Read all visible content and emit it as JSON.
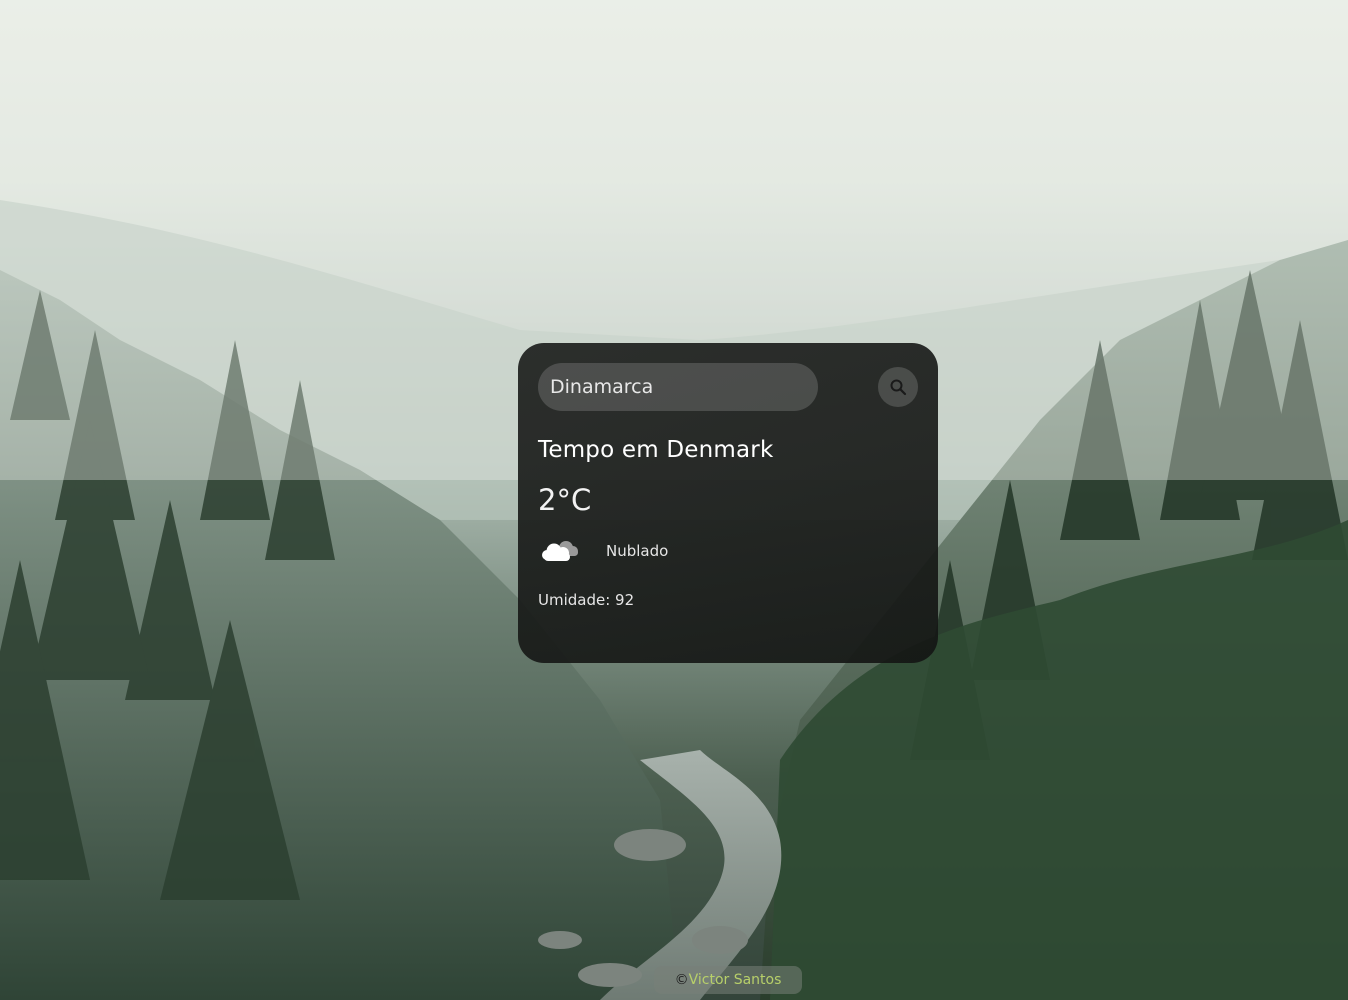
{
  "search": {
    "value": "Dinamarca",
    "placeholder": "Dinamarca"
  },
  "weather": {
    "title": "Tempo em Denmark",
    "temperature": "2°C",
    "description": "Nublado",
    "humidity": "Umidade: 92",
    "icon": "cloudy-icon"
  },
  "footer": {
    "copyright_symbol": "©",
    "author": "Victor Santos"
  },
  "colors": {
    "card_bg": "#1c1e1c",
    "credit_link": "#b7cf6a"
  }
}
